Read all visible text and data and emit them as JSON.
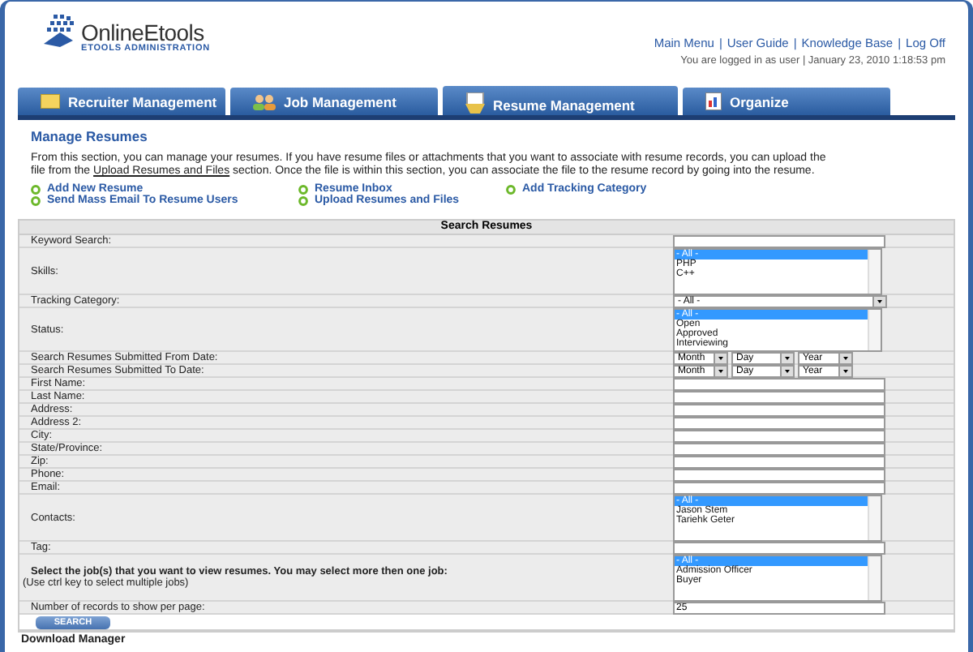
{
  "logo": {
    "name": "OnlineEtools",
    "tagline": "ETOOLS ADMINISTRATION"
  },
  "top_links": {
    "separator": "|",
    "items": [
      "Main Menu",
      "User Guide",
      "Knowledge Base",
      "Log Off"
    ]
  },
  "login_info": "You are logged in as user | January 23, 2010 1:18:53 pm",
  "tabs": [
    {
      "label": "Recruiter Management",
      "kind": "folder",
      "selected": false
    },
    {
      "label": "Job Management",
      "kind": "people",
      "selected": false
    },
    {
      "label": "Resume Management",
      "kind": "resume",
      "selected": true
    },
    {
      "label": "Organize",
      "kind": "chart",
      "selected": false
    }
  ],
  "page_title": "Manage Resumes",
  "intro": {
    "before": "From this section, you can manage your resumes. If you have resume files or attachments that you want to associate with resume records, you can upload the file from the",
    "link": "Upload Resumes and Files",
    "after": "section. Once the file is within this section, you can associate the file to the resume record by going into the resume."
  },
  "actions": [
    [
      "Add New Resume",
      "Send Mass Email To Resume Users"
    ],
    [
      "Resume Inbox",
      "Upload Resumes and Files"
    ],
    [
      "Add Tracking Category"
    ]
  ],
  "search_form": {
    "title": "Search Resumes",
    "rows": [
      {
        "label": "Keyword Search:",
        "kind": "text"
      },
      {
        "label": "Skills:",
        "kind": "listbox",
        "options": [
          {
            "label": "- All -",
            "selected": true
          },
          {
            "label": "PHP",
            "selected": false
          },
          {
            "label": "C++",
            "selected": false
          }
        ]
      },
      {
        "label": "Tracking Category:",
        "kind": "select",
        "value": "- All -"
      },
      {
        "label": "Status:",
        "kind": "listbox",
        "options": [
          {
            "label": "- All -",
            "selected": true
          },
          {
            "label": "Open",
            "selected": false
          },
          {
            "label": "Approved",
            "selected": false
          },
          {
            "label": "Interviewing",
            "selected": false
          }
        ]
      },
      {
        "label": "Search Resumes Submitted From Date:",
        "kind": "date",
        "parts": [
          "Month",
          "Day",
          "Year"
        ]
      },
      {
        "label": "Search Resumes Submitted To Date:",
        "kind": "date",
        "parts": [
          "Month",
          "Day",
          "Year"
        ]
      },
      {
        "label": "First Name:",
        "kind": "text"
      },
      {
        "label": "Last Name:",
        "kind": "text"
      },
      {
        "label": "Address:",
        "kind": "text"
      },
      {
        "label": "Address 2:",
        "kind": "text"
      },
      {
        "label": "City:",
        "kind": "text"
      },
      {
        "label": "State/Province:",
        "kind": "text"
      },
      {
        "label": "Zip:",
        "kind": "text"
      },
      {
        "label": "Phone:",
        "kind": "text"
      },
      {
        "label": "Email:",
        "kind": "text"
      },
      {
        "label": "Contacts:",
        "kind": "listbox",
        "options": [
          {
            "label": "- All -",
            "selected": true
          },
          {
            "label": "Jason Stem",
            "selected": false
          },
          {
            "label": "Tariehk Geter",
            "selected": false
          }
        ]
      },
      {
        "label": "Tag:",
        "kind": "text"
      },
      {
        "label": "Select the job(s) that you want to view resumes. You may select more then one job:",
        "note": "(Use ctrl key to select multiple jobs)",
        "kind": "listbox",
        "options": [
          {
            "label": "- All -",
            "selected": true
          },
          {
            "label": "Admission Officer",
            "selected": false
          },
          {
            "label": "Buyer",
            "selected": false
          }
        ]
      },
      {
        "label": "Number of records to show per page:",
        "kind": "text",
        "value": "25"
      }
    ],
    "button": "SEARCH"
  },
  "footer_heading": "Download Manager"
}
